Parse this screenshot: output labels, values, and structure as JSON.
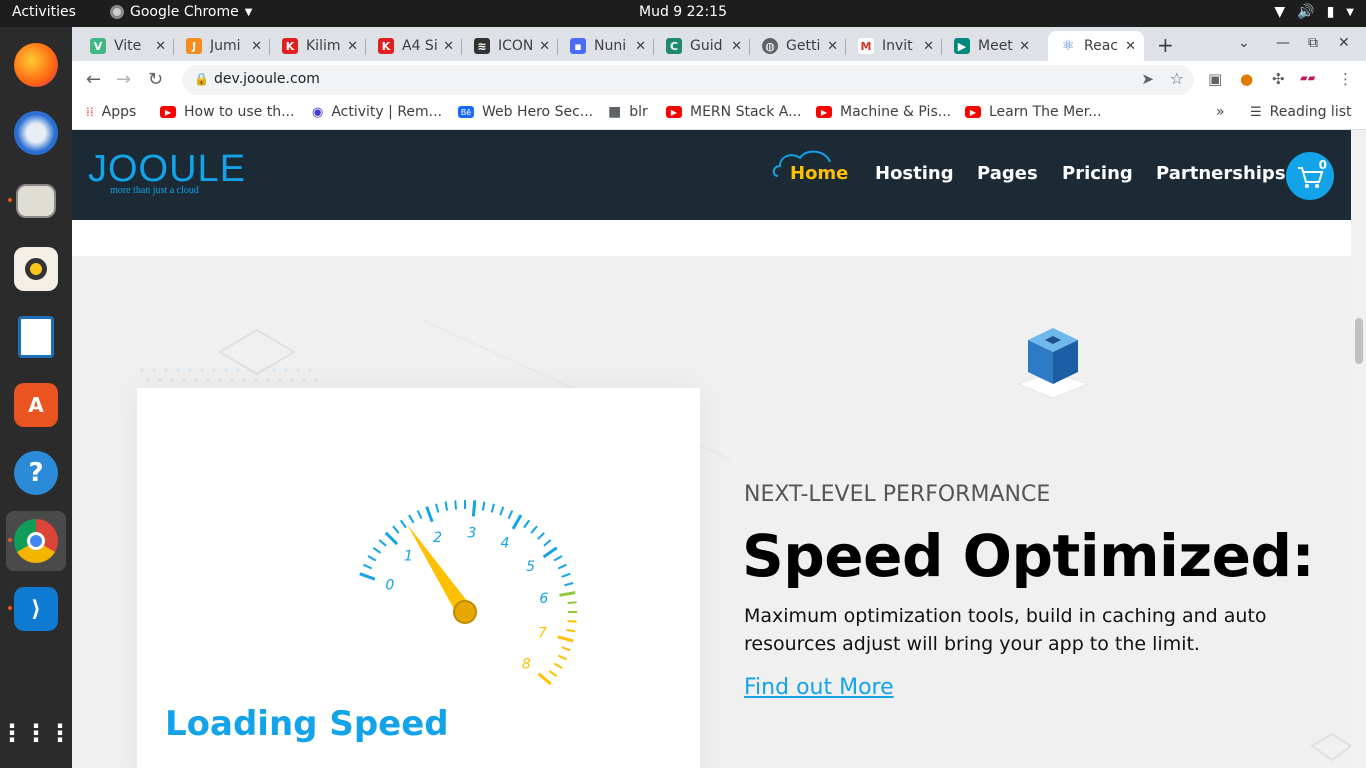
{
  "system": {
    "activities": "Activities",
    "app_name": "Google Chrome",
    "clock": "Mud 9  22:15"
  },
  "tabs": [
    {
      "title": "Vite",
      "favicon": "vue-icon",
      "color": "#41b883"
    },
    {
      "title": "Jumi",
      "favicon": "cart-icon",
      "color": "#f68b1e"
    },
    {
      "title": "Kilim",
      "favicon": "page-icon",
      "color": "#e02020"
    },
    {
      "title": "A4 Si",
      "favicon": "page-icon",
      "color": "#e02020"
    },
    {
      "title": "ICON",
      "favicon": "layers-icon",
      "color": "#333333"
    },
    {
      "title": "Nuni",
      "favicon": "grid-icon",
      "color": "#4a6cf7"
    },
    {
      "title": "Guid",
      "favicon": "c-icon",
      "color": "#1f8a70"
    },
    {
      "title": "Getti",
      "favicon": "globe-icon",
      "color": "#5f6368"
    },
    {
      "title": "Invit",
      "favicon": "gmail-icon",
      "color": "#d93025"
    },
    {
      "title": "Meet",
      "favicon": "meet-icon",
      "color": "#00897b"
    },
    {
      "title": "Reac",
      "favicon": "react-icon",
      "color": "#3a7bd5"
    }
  ],
  "address_bar": {
    "url": "dev.jooule.com"
  },
  "bookmarks": [
    {
      "label": "Apps",
      "color": "#ea4335"
    },
    {
      "label": "How to use th...",
      "color": "#ff0000"
    },
    {
      "label": "Activity | Rem...",
      "color": "#3b3bd1"
    },
    {
      "label": "Web Hero Sec...",
      "color": "#1769ff"
    },
    {
      "label": "blr",
      "color": "#5f6368"
    },
    {
      "label": "MERN Stack A...",
      "color": "#ff0000"
    },
    {
      "label": "Machine & Pis...",
      "color": "#ff0000"
    },
    {
      "label": "Learn The Mer...",
      "color": "#ff0000"
    }
  ],
  "bookmarks_overflow": "»",
  "reading_list": "Reading list",
  "site": {
    "logo": "JOOULE",
    "tagline": "more than just a cloud",
    "nav": [
      "Home",
      "Hosting",
      "Pages",
      "Pricing",
      "Partnerships"
    ],
    "cart_count": "0",
    "card_title": "Loading Speed",
    "eyebrow": "NEXT-LEVEL PERFORMANCE",
    "headline": "Speed Optimized:",
    "description": "Maximum optimization tools, build in caching and auto resources adjust will bring your app to the limit.",
    "cta": "Find out More",
    "gauge_labels": [
      "0",
      "1",
      "2",
      "3",
      "4",
      "5",
      "6",
      "7",
      "8"
    ]
  },
  "colors": {
    "accent": "#12a3e8",
    "nav_bg": "#1b2a35",
    "active_nav": "#ffc000"
  }
}
